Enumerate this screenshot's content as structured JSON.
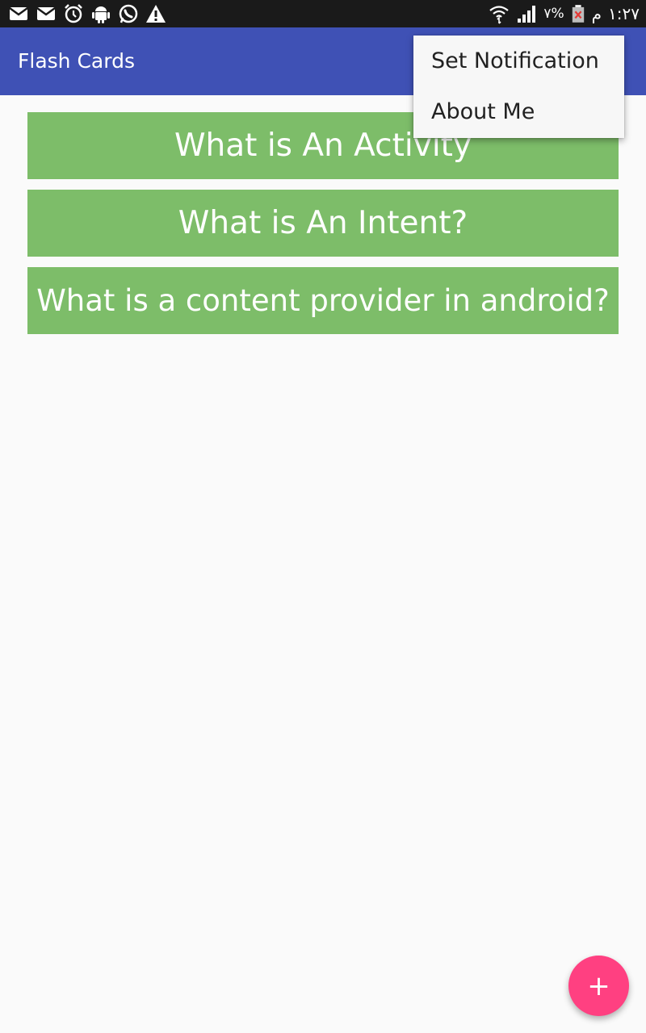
{
  "status_bar": {
    "icons_left": [
      "mail-icon",
      "mail-icon",
      "alarm-icon",
      "android-icon",
      "whatsapp-icon",
      "warning-icon"
    ],
    "icons_right": [
      "wifi-icon",
      "signal-icon"
    ],
    "battery_percent": "٧%",
    "battery_icon": "battery-alert-icon",
    "period": "م",
    "time": "١:٢٧"
  },
  "app_bar": {
    "title": "Flash Cards"
  },
  "cards": [
    {
      "label": "What is An Activity"
    },
    {
      "label": "What is An Intent?"
    },
    {
      "label": "What is a content provider in android?"
    }
  ],
  "overflow_menu": {
    "items": [
      {
        "label": "Set Notification"
      },
      {
        "label": "About Me"
      }
    ]
  },
  "fab": {
    "icon": "plus-icon",
    "symbol": "+"
  },
  "colors": {
    "status_bar": "#1a1a1a",
    "primary": "#3f51b5",
    "card": "#7dbd69",
    "accent": "#ff4081",
    "background": "#fafafa"
  }
}
